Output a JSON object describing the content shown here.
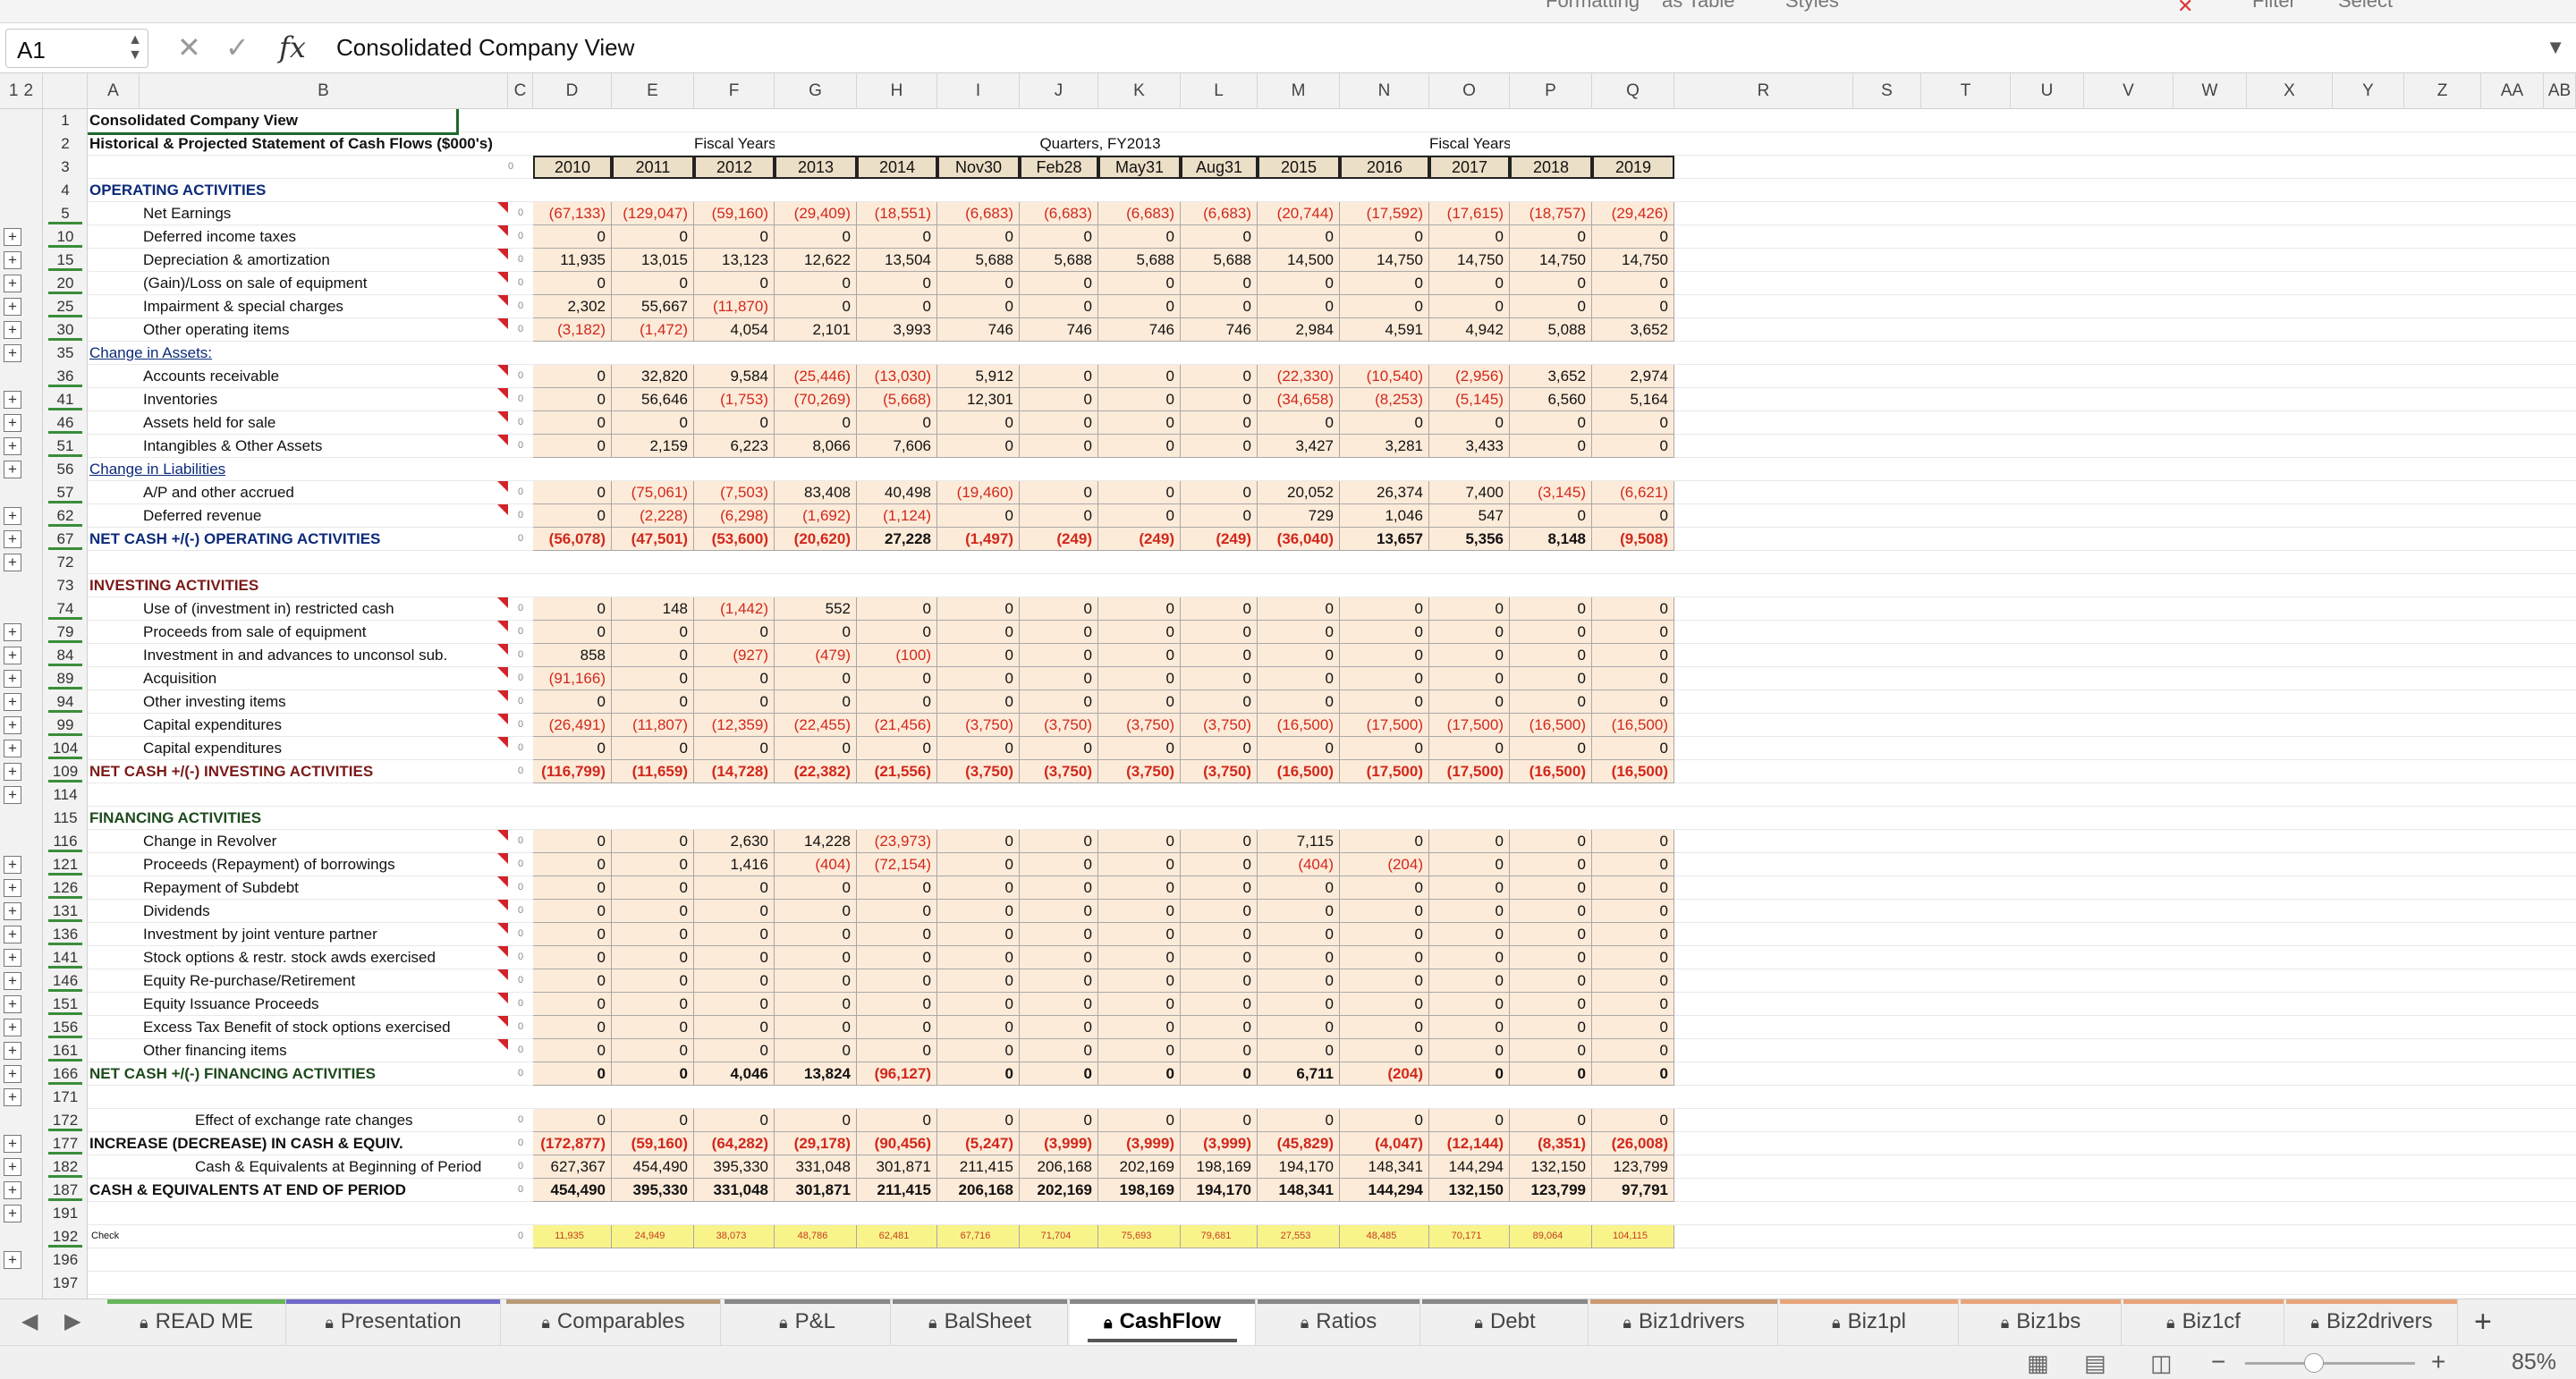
{
  "top_hints": [
    "Formatting",
    "as Table",
    "Styles",
    "Filter",
    "Select"
  ],
  "name_box": "A1",
  "formula_bar": {
    "content": "Consolidated Company View",
    "fx": "fx",
    "cancel": "✕",
    "enter": "✓"
  },
  "outline_levels": [
    "1",
    "2"
  ],
  "columns": [
    "A",
    "B",
    "C",
    "D",
    "E",
    "F",
    "G",
    "H",
    "I",
    "J",
    "K",
    "L",
    "M",
    "N",
    "O",
    "P",
    "Q",
    "R",
    "S",
    "T",
    "U",
    "V",
    "W",
    "X",
    "Y",
    "Z",
    "AA",
    "AB"
  ],
  "title1": "Consolidated Company View",
  "title2": "Historical & Projected Statement of Cash Flows ($000's)",
  "group_fiscal1": "Fiscal Years:",
  "group_quarters": "Quarters, FY2013",
  "group_fiscal2": "Fiscal Years:",
  "c_marker": "0",
  "years": [
    "2010",
    "2011",
    "2012",
    "2013",
    "2014",
    "Nov30",
    "Feb28",
    "May31",
    "Aug31",
    "2015",
    "2016",
    "2017",
    "2018",
    "2019"
  ],
  "rows": [
    {
      "r": "5",
      "label": "Net Earnings",
      "v": [
        "(67,133)",
        "(129,047)",
        "(59,160)",
        "(29,409)",
        "(18,551)",
        "(6,683)",
        "(6,683)",
        "(6,683)",
        "(6,683)",
        "(20,744)",
        "(17,592)",
        "(17,615)",
        "(18,757)",
        "(29,426)"
      ]
    },
    {
      "r": "10",
      "label": "Deferred income taxes",
      "v": [
        "0",
        "0",
        "0",
        "0",
        "0",
        "0",
        "0",
        "0",
        "0",
        "0",
        "0",
        "0",
        "0",
        "0"
      ]
    },
    {
      "r": "15",
      "label": "Depreciation & amortization",
      "v": [
        "11,935",
        "13,015",
        "13,123",
        "12,622",
        "13,504",
        "5,688",
        "5,688",
        "5,688",
        "5,688",
        "14,500",
        "14,750",
        "14,750",
        "14,750",
        "14,750"
      ]
    },
    {
      "r": "20",
      "label": "(Gain)/Loss on sale of equipment",
      "v": [
        "0",
        "0",
        "0",
        "0",
        "0",
        "0",
        "0",
        "0",
        "0",
        "0",
        "0",
        "0",
        "0",
        "0"
      ]
    },
    {
      "r": "25",
      "label": "Impairment & special charges",
      "v": [
        "2,302",
        "55,667",
        "(11,870)",
        "0",
        "0",
        "0",
        "0",
        "0",
        "0",
        "0",
        "0",
        "0",
        "0",
        "0"
      ]
    },
    {
      "r": "30",
      "label": "Other operating items",
      "v": [
        "(3,182)",
        "(1,472)",
        "4,054",
        "2,101",
        "3,993",
        "746",
        "746",
        "746",
        "746",
        "2,984",
        "4,591",
        "4,942",
        "5,088",
        "3,652"
      ]
    },
    {
      "r": "36",
      "label": "Accounts receivable",
      "v": [
        "0",
        "32,820",
        "9,584",
        "(25,446)",
        "(13,030)",
        "5,912",
        "0",
        "0",
        "0",
        "(22,330)",
        "(10,540)",
        "(2,956)",
        "3,652",
        "2,974"
      ]
    },
    {
      "r": "41",
      "label": "Inventories",
      "v": [
        "0",
        "56,646",
        "(1,753)",
        "(70,269)",
        "(5,668)",
        "12,301",
        "0",
        "0",
        "0",
        "(34,658)",
        "(8,253)",
        "(5,145)",
        "6,560",
        "5,164"
      ]
    },
    {
      "r": "46",
      "label": "Assets held for sale",
      "v": [
        "0",
        "0",
        "0",
        "0",
        "0",
        "0",
        "0",
        "0",
        "0",
        "0",
        "0",
        "0",
        "0",
        "0"
      ]
    },
    {
      "r": "51",
      "label": "Intangibles & Other Assets",
      "v": [
        "0",
        "2,159",
        "6,223",
        "8,066",
        "7,606",
        "0",
        "0",
        "0",
        "0",
        "3,427",
        "3,281",
        "3,433",
        "0",
        "0"
      ]
    },
    {
      "r": "57",
      "label": "A/P and other accrued",
      "v": [
        "0",
        "(75,061)",
        "(7,503)",
        "83,408",
        "40,498",
        "(19,460)",
        "0",
        "0",
        "0",
        "20,052",
        "26,374",
        "7,400",
        "(3,145)",
        "(6,621)"
      ]
    },
    {
      "r": "62",
      "label": "Deferred revenue",
      "v": [
        "0",
        "(2,228)",
        "(6,298)",
        "(1,692)",
        "(1,124)",
        "0",
        "0",
        "0",
        "0",
        "729",
        "1,046",
        "547",
        "0",
        "0"
      ]
    },
    {
      "r": "67",
      "label": "NET CASH +/(-) OPERATING ACTIVITIES",
      "v": [
        "(56,078)",
        "(47,501)",
        "(53,600)",
        "(20,620)",
        "27,228",
        "(1,497)",
        "(249)",
        "(249)",
        "(249)",
        "(36,040)",
        "13,657",
        "5,356",
        "8,148",
        "(9,508)"
      ]
    },
    {
      "r": "74",
      "label": "Use of (investment in) restricted cash",
      "v": [
        "0",
        "148",
        "(1,442)",
        "552",
        "0",
        "0",
        "0",
        "0",
        "0",
        "0",
        "0",
        "0",
        "0",
        "0"
      ]
    },
    {
      "r": "79",
      "label": "Proceeds from sale of equipment",
      "v": [
        "0",
        "0",
        "0",
        "0",
        "0",
        "0",
        "0",
        "0",
        "0",
        "0",
        "0",
        "0",
        "0",
        "0"
      ]
    },
    {
      "r": "84",
      "label": "Investment in and advances to unconsol sub.",
      "v": [
        "858",
        "0",
        "(927)",
        "(479)",
        "(100)",
        "0",
        "0",
        "0",
        "0",
        "0",
        "0",
        "0",
        "0",
        "0"
      ]
    },
    {
      "r": "89",
      "label": "Acquisition",
      "v": [
        "(91,166)",
        "0",
        "0",
        "0",
        "0",
        "0",
        "0",
        "0",
        "0",
        "0",
        "0",
        "0",
        "0",
        "0"
      ]
    },
    {
      "r": "94",
      "label": "Other investing items",
      "v": [
        "0",
        "0",
        "0",
        "0",
        "0",
        "0",
        "0",
        "0",
        "0",
        "0",
        "0",
        "0",
        "0",
        "0"
      ]
    },
    {
      "r": "99",
      "label": "Capital expenditures",
      "v": [
        "(26,491)",
        "(11,807)",
        "(12,359)",
        "(22,455)",
        "(21,456)",
        "(3,750)",
        "(3,750)",
        "(3,750)",
        "(3,750)",
        "(16,500)",
        "(17,500)",
        "(17,500)",
        "(16,500)",
        "(16,500)"
      ]
    },
    {
      "r": "104",
      "label": "Capital expenditures",
      "v": [
        "0",
        "0",
        "0",
        "0",
        "0",
        "0",
        "0",
        "0",
        "0",
        "0",
        "0",
        "0",
        "0",
        "0"
      ]
    },
    {
      "r": "109",
      "label": "NET CASH +/(-) INVESTING ACTIVITIES",
      "v": [
        "(116,799)",
        "(11,659)",
        "(14,728)",
        "(22,382)",
        "(21,556)",
        "(3,750)",
        "(3,750)",
        "(3,750)",
        "(3,750)",
        "(16,500)",
        "(17,500)",
        "(17,500)",
        "(16,500)",
        "(16,500)"
      ]
    },
    {
      "r": "116",
      "label": "Change in Revolver",
      "v": [
        "0",
        "0",
        "2,630",
        "14,228",
        "(23,973)",
        "0",
        "0",
        "0",
        "0",
        "7,115",
        "0",
        "0",
        "0",
        "0"
      ]
    },
    {
      "r": "121",
      "label": "Proceeds (Repayment) of borrowings",
      "v": [
        "0",
        "0",
        "1,416",
        "(404)",
        "(72,154)",
        "0",
        "0",
        "0",
        "0",
        "(404)",
        "(204)",
        "0",
        "0",
        "0"
      ]
    },
    {
      "r": "126",
      "label": "Repayment of Subdebt",
      "v": [
        "0",
        "0",
        "0",
        "0",
        "0",
        "0",
        "0",
        "0",
        "0",
        "0",
        "0",
        "0",
        "0",
        "0"
      ]
    },
    {
      "r": "131",
      "label": "Dividends",
      "v": [
        "0",
        "0",
        "0",
        "0",
        "0",
        "0",
        "0",
        "0",
        "0",
        "0",
        "0",
        "0",
        "0",
        "0"
      ]
    },
    {
      "r": "136",
      "label": "Investment by joint venture partner",
      "v": [
        "0",
        "0",
        "0",
        "0",
        "0",
        "0",
        "0",
        "0",
        "0",
        "0",
        "0",
        "0",
        "0",
        "0"
      ]
    },
    {
      "r": "141",
      "label": "Stock options & restr. stock awds exercised",
      "v": [
        "0",
        "0",
        "0",
        "0",
        "0",
        "0",
        "0",
        "0",
        "0",
        "0",
        "0",
        "0",
        "0",
        "0"
      ]
    },
    {
      "r": "146",
      "label": "Equity Re-purchase/Retirement",
      "v": [
        "0",
        "0",
        "0",
        "0",
        "0",
        "0",
        "0",
        "0",
        "0",
        "0",
        "0",
        "0",
        "0",
        "0"
      ]
    },
    {
      "r": "151",
      "label": "Equity Issuance Proceeds",
      "v": [
        "0",
        "0",
        "0",
        "0",
        "0",
        "0",
        "0",
        "0",
        "0",
        "0",
        "0",
        "0",
        "0",
        "0"
      ]
    },
    {
      "r": "156",
      "label": "Excess Tax Benefit of stock options exercised",
      "v": [
        "0",
        "0",
        "0",
        "0",
        "0",
        "0",
        "0",
        "0",
        "0",
        "0",
        "0",
        "0",
        "0",
        "0"
      ]
    },
    {
      "r": "161",
      "label": "Other financing items",
      "v": [
        "0",
        "0",
        "0",
        "0",
        "0",
        "0",
        "0",
        "0",
        "0",
        "0",
        "0",
        "0",
        "0",
        "0"
      ]
    },
    {
      "r": "166",
      "label": "NET CASH +/(-) FINANCING ACTIVITIES",
      "v": [
        "0",
        "0",
        "4,046",
        "13,824",
        "(96,127)",
        "0",
        "0",
        "0",
        "0",
        "6,711",
        "(204)",
        "0",
        "0",
        "0"
      ]
    },
    {
      "r": "172",
      "label": "Effect of exchange rate changes",
      "v": [
        "0",
        "0",
        "0",
        "0",
        "0",
        "0",
        "0",
        "0",
        "0",
        "0",
        "0",
        "0",
        "0",
        "0"
      ]
    },
    {
      "r": "177",
      "label": "INCREASE (DECREASE) IN CASH & EQUIV.",
      "v": [
        "(172,877)",
        "(59,160)",
        "(64,282)",
        "(29,178)",
        "(90,456)",
        "(5,247)",
        "(3,999)",
        "(3,999)",
        "(3,999)",
        "(45,829)",
        "(4,047)",
        "(12,144)",
        "(8,351)",
        "(26,008)"
      ]
    },
    {
      "r": "182",
      "label": "Cash & Equivalents at Beginning of Period",
      "v": [
        "627,367",
        "454,490",
        "395,330",
        "331,048",
        "301,871",
        "211,415",
        "206,168",
        "202,169",
        "198,169",
        "194,170",
        "148,341",
        "144,294",
        "132,150",
        "123,799"
      ]
    },
    {
      "r": "187",
      "label": "CASH & EQUIVALENTS AT END OF PERIOD",
      "v": [
        "454,490",
        "395,330",
        "331,048",
        "301,871",
        "211,415",
        "206,168",
        "202,169",
        "198,169",
        "194,170",
        "148,341",
        "144,294",
        "132,150",
        "123,799",
        "97,791"
      ]
    },
    {
      "r": "192",
      "label": "Check",
      "v": [
        "11,935",
        "24,949",
        "38,073",
        "48,786",
        "62,481",
        "67,716",
        "71,704",
        "75,693",
        "79,681",
        "27,553",
        "48,485",
        "70,171",
        "89,064",
        "104,115"
      ]
    }
  ],
  "headers": {
    "r4": "OPERATING ACTIVITIES",
    "r35": "Change in Assets:",
    "r56": "Change in Liabilities",
    "r73": "INVESTING ACTIVITIES",
    "r115": "FINANCING ACTIVITIES"
  },
  "tabs": [
    {
      "name": "READ ME",
      "color": "#67b55a"
    },
    {
      "name": "Presentation",
      "color": "#6f6ac8"
    },
    {
      "name": "Comparables",
      "color": "#b89a7a"
    },
    {
      "name": "P&L",
      "color": "#888888"
    },
    {
      "name": "BalSheet",
      "color": "#888888"
    },
    {
      "name": "CashFlow",
      "color": "#888888"
    },
    {
      "name": "Ratios",
      "color": "#888888"
    },
    {
      "name": "Debt",
      "color": "#888888"
    },
    {
      "name": "Biz1drivers",
      "color": "#c99a72"
    },
    {
      "name": "Biz1pl",
      "color": "#e8a57a"
    },
    {
      "name": "Biz1bs",
      "color": "#e8a57a"
    },
    {
      "name": "Biz1cf",
      "color": "#e8a57a"
    },
    {
      "name": "Biz2drivers",
      "color": "#e8a57a"
    }
  ],
  "active_tab": "CashFlow",
  "add_sheet": "+",
  "zoom": "85%"
}
